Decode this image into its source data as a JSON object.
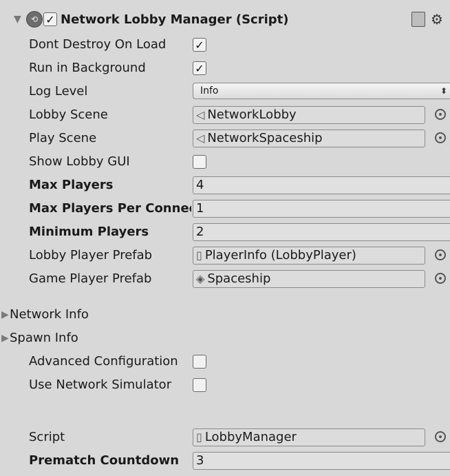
{
  "header": {
    "title": "Network Lobby Manager (Script)",
    "enabled": true,
    "icons": [
      "foldout-expanded-icon",
      "script-component-icon",
      "help-book-icon",
      "gear-icon"
    ]
  },
  "fields": {
    "dont_destroy": {
      "label": "Dont Destroy On Load",
      "checked": true
    },
    "run_background": {
      "label": "Run in Background",
      "checked": true
    },
    "log_level": {
      "label": "Log Level",
      "value": "Info"
    },
    "lobby_scene": {
      "label": "Lobby Scene",
      "value": "NetworkLobby"
    },
    "play_scene": {
      "label": "Play Scene",
      "value": "NetworkSpaceship"
    },
    "show_gui": {
      "label": "Show Lobby GUI",
      "checked": false
    },
    "max_players": {
      "label": "Max Players",
      "value": "4"
    },
    "max_per_conn": {
      "label": "Max Players Per Connection",
      "value": "1"
    },
    "min_players": {
      "label": "Minimum Players",
      "value": "2"
    },
    "lobby_prefab": {
      "label": "Lobby Player Prefab",
      "value": "PlayerInfo (LobbyPlayer)"
    },
    "game_prefab": {
      "label": "Game Player Prefab",
      "value": "Spaceship"
    }
  },
  "sections": {
    "network_info": "Network Info",
    "spawn_info": "Spawn Info"
  },
  "advanced": {
    "adv_config": {
      "label": "Advanced Configuration",
      "checked": false
    },
    "net_sim": {
      "label": "Use Network Simulator",
      "checked": false
    }
  },
  "script": {
    "label": "Script",
    "value": "LobbyManager"
  },
  "prematch": {
    "label": "Prematch Countdown",
    "value": "3"
  }
}
